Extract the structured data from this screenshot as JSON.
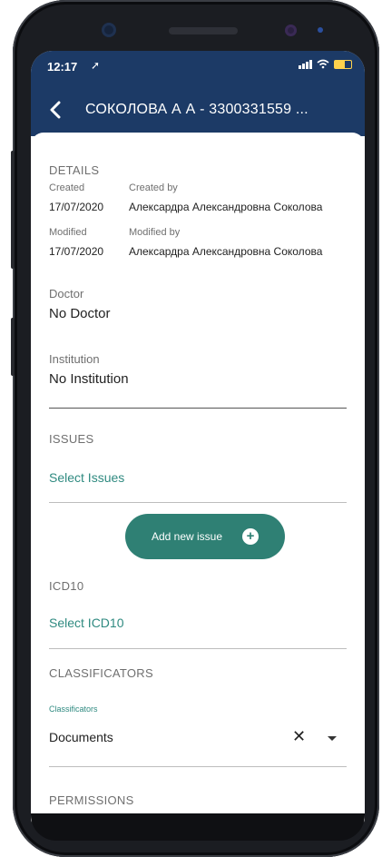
{
  "status": {
    "time": "12:17"
  },
  "appbar": {
    "title": "СОКОЛОВА А А - 3300331559 ..."
  },
  "details": {
    "section": "DETAILS",
    "created_label": "Created",
    "created_date": "17/07/2020",
    "created_by_label": "Created by",
    "created_by": "Алексардра Александровна  Соколова",
    "modified_label": "Modified",
    "modified_date": "17/07/2020",
    "modified_by_label": "Modified by",
    "modified_by": "Алексардра Александровна  Соколова"
  },
  "doctor": {
    "label": "Doctor",
    "value": "No Doctor"
  },
  "institution": {
    "label": "Institution",
    "value": "No Institution"
  },
  "issues": {
    "section": "ISSUES",
    "select": "Select Issues",
    "add_button": "Add new issue"
  },
  "icd10": {
    "section": "ICD10",
    "select": "Select ICD10"
  },
  "classificators": {
    "section": "CLASSIFICATORS",
    "field_label": "Classificators",
    "value": "Documents"
  },
  "permissions": {
    "section": "PERMISSIONS"
  },
  "colors": {
    "header": "#1c3a66",
    "accent": "#2f8074",
    "link": "#2f8a80"
  }
}
